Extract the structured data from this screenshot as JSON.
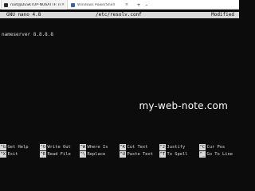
{
  "window": {
    "tabs": [
      {
        "label": "root@DESKTOP-NU6ATTF: /etc",
        "active": true,
        "close": "×"
      },
      {
        "label": "Windows PowerShell",
        "active": false,
        "close": "×"
      }
    ],
    "new_tab": "+",
    "dropdown": "⌄"
  },
  "nano": {
    "version": "GNU nano 4.8",
    "filename": "/etc/resolv.conf",
    "status": "Modified",
    "buffer_lines": [
      "nameserver 8.8.8.8"
    ]
  },
  "watermark": "my-web-note.com",
  "shortcuts": [
    {
      "key": "^G",
      "label": "Get Help"
    },
    {
      "key": "^O",
      "label": "Write Out"
    },
    {
      "key": "^W",
      "label": "Where Is"
    },
    {
      "key": "^K",
      "label": "Cut Text"
    },
    {
      "key": "^J",
      "label": "Justify"
    },
    {
      "key": "^C",
      "label": "Cur Pos"
    },
    {
      "key": "^X",
      "label": "Exit"
    },
    {
      "key": "^R",
      "label": "Read File"
    },
    {
      "key": "^\\",
      "label": "Replace"
    },
    {
      "key": "^U",
      "label": "Paste Text"
    },
    {
      "key": "^T",
      "label": "To Spell"
    },
    {
      "key": "^_",
      "label": "Go To Line"
    }
  ],
  "colors": {
    "terminal_bg": "#0c0c0c",
    "terminal_fg": "#d9d9d9",
    "titlebar_bg": "#ffffff"
  }
}
